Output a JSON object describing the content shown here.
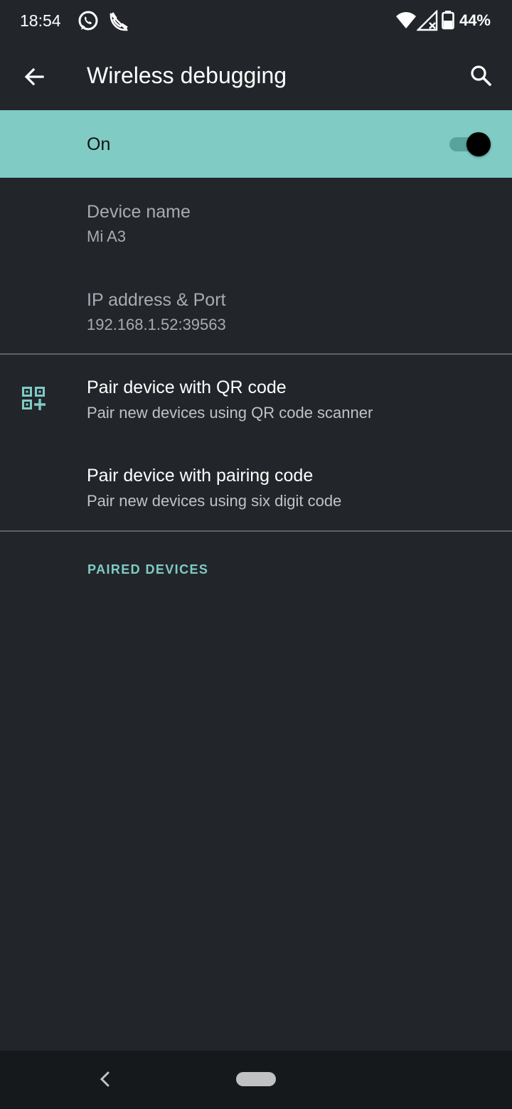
{
  "status_bar": {
    "time": "18:54",
    "battery_percent": "44%",
    "icons": [
      "whatsapp-icon",
      "phone-missed-icon",
      "wifi-icon",
      "signal-icon",
      "battery-icon"
    ]
  },
  "app_bar": {
    "title": "Wireless debugging",
    "back_icon": "arrow-back-icon",
    "search_icon": "search-icon"
  },
  "main_switch": {
    "label": "On",
    "checked": true
  },
  "device_info": [
    {
      "title": "Device name",
      "summary": "Mi A3"
    },
    {
      "title": "IP address & Port",
      "summary": "192.168.1.52:39563"
    }
  ],
  "pair_options": [
    {
      "title": "Pair device with QR code",
      "summary": "Pair new devices using QR code scanner",
      "icon": "qr-code-add-icon"
    },
    {
      "title": "Pair device with pairing code",
      "summary": "Pair new devices using six digit code"
    }
  ],
  "paired_devices_header": "PAIRED DEVICES",
  "colors": {
    "background": "#22262b",
    "accent": "#80cbc4",
    "navbar": "#16191c"
  }
}
